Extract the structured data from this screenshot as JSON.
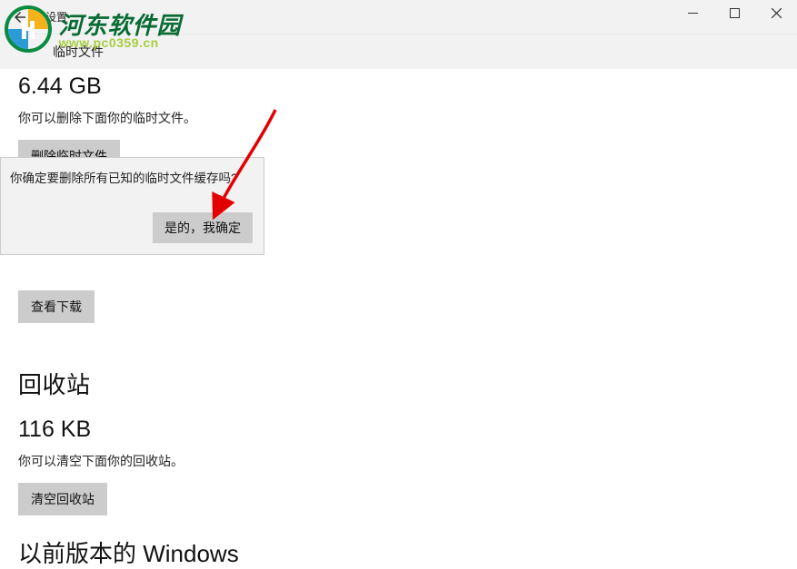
{
  "titlebar": {
    "title": "设置"
  },
  "header": {
    "section_title": "临时文件"
  },
  "temp_files": {
    "size": "6.44 GB",
    "desc": "你可以删除下面你的临时文件。",
    "delete_btn": "删除临时文件"
  },
  "dialog": {
    "message": "你确定要删除所有已知的临时文件缓存吗?",
    "confirm_btn": "是的，我确定"
  },
  "downloads": {
    "view_btn": "查看下载"
  },
  "recycle": {
    "title": "回收站",
    "size": "116 KB",
    "desc": "你可以清空下面你的回收站。",
    "empty_btn": "清空回收站"
  },
  "prev_windows": {
    "title": "以前版本的 Windows"
  },
  "watermark": {
    "main": "河东软件园",
    "sub": "www.pc0359.cn"
  }
}
